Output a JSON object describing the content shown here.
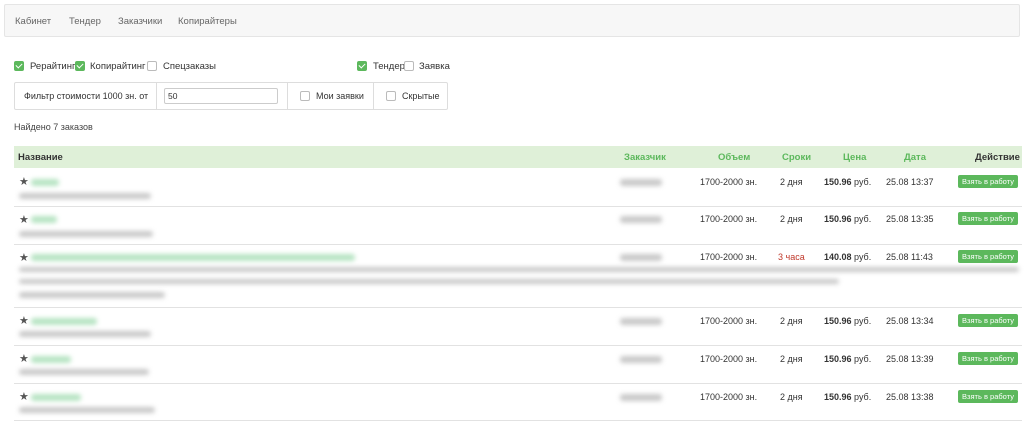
{
  "nav": {
    "items": [
      "Кабинет",
      "Тендер",
      "Заказчики",
      "Копирайтеры"
    ]
  },
  "filters": {
    "rewriting": {
      "label": "Рерайтинг",
      "checked": true
    },
    "copywriting": {
      "label": "Копирайтинг",
      "checked": true
    },
    "special": {
      "label": "Спецзаказы",
      "checked": false
    },
    "tender": {
      "label": "Тендер",
      "checked": true
    },
    "request": {
      "label": "Заявка",
      "checked": false
    },
    "price_filter_label": "Фильтр стоимости 1000 зн. от",
    "price_filter_value": "50",
    "my_requests": {
      "label": "Мои заявки",
      "checked": false
    },
    "hidden": {
      "label": "Скрытые",
      "checked": false
    }
  },
  "found_text": "Найдено 7 заказов",
  "table": {
    "headers": {
      "title": "Название",
      "customer": "Заказчик",
      "volume": "Объем",
      "deadline": "Сроки",
      "price": "Цена",
      "date": "Дата",
      "action": "Действие"
    },
    "rows": [
      {
        "volume": "1700-2000 зн.",
        "deadline": "2 дня",
        "price_value": "150.96",
        "price_unit": "руб.",
        "date": "25.08 13:37",
        "action": "Взять в работу",
        "deadline_urgent": false
      },
      {
        "volume": "1700-2000 зн.",
        "deadline": "2 дня",
        "price_value": "150.96",
        "price_unit": "руб.",
        "date": "25.08 13:35",
        "action": "Взять в работу",
        "deadline_urgent": false
      },
      {
        "volume": "1700-2000 зн.",
        "deadline": "3 часа",
        "price_value": "140.08",
        "price_unit": "руб.",
        "date": "25.08 11:43",
        "action": "Взять в работу",
        "deadline_urgent": true
      },
      {
        "volume": "1700-2000 зн.",
        "deadline": "2 дня",
        "price_value": "150.96",
        "price_unit": "руб.",
        "date": "25.08 13:34",
        "action": "Взять в работу",
        "deadline_urgent": false
      },
      {
        "volume": "1700-2000 зн.",
        "deadline": "2 дня",
        "price_value": "150.96",
        "price_unit": "руб.",
        "date": "25.08 13:39",
        "action": "Взять в работу",
        "deadline_urgent": false
      },
      {
        "volume": "1700-2000 зн.",
        "deadline": "2 дня",
        "price_value": "150.96",
        "price_unit": "руб.",
        "date": "25.08 13:38",
        "action": "Взять в работу",
        "deadline_urgent": false
      }
    ]
  },
  "colors": {
    "accent": "#5cb85c",
    "header_bg": "#dff0d8",
    "urgent": "#c0392b"
  },
  "icons": {
    "favorite": "star-icon",
    "checkbox": "checkbox-icon"
  }
}
